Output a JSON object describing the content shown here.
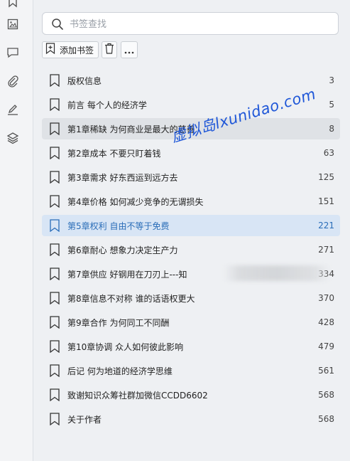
{
  "rail": {
    "icons": [
      "bookmark-icon",
      "image-icon",
      "comment-icon",
      "attachment-icon",
      "pen-icon",
      "layers-icon"
    ]
  },
  "search": {
    "placeholder": "书签查找",
    "value": ""
  },
  "toolbar": {
    "add_label": "添加书签"
  },
  "bookmarks": [
    {
      "title": "版权信息",
      "page": "3"
    },
    {
      "title": "前言 每个人的经济学",
      "page": "5"
    },
    {
      "title": "第1章稀缺 为何商业是最大的慈善",
      "page": "8"
    },
    {
      "title": "第2章成本 不要只盯着钱",
      "page": "63"
    },
    {
      "title": "第3章需求 好东西运到远方去",
      "page": "125"
    },
    {
      "title": "第4章价格 如何减少竞争的无谓损失",
      "page": "151"
    },
    {
      "title": "第5章权利 自由不等于免费",
      "page": "221"
    },
    {
      "title": "第6章耐心 想象力决定生产力",
      "page": "271"
    },
    {
      "title": "第7章供应 好钢用在刀刃上---知",
      "page": "334"
    },
    {
      "title": "第8章信息不对称 谁的话语权更大",
      "page": "370"
    },
    {
      "title": "第9章合作 为何同工不同酬",
      "page": "428"
    },
    {
      "title": "第10章协调 众人如何彼此影响",
      "page": "479"
    },
    {
      "title": "后记 何为地道的经济学思维",
      "page": "561"
    },
    {
      "title": "致谢知识众筹社群加微信CCDD6602",
      "page": "568"
    },
    {
      "title": "关于作者",
      "page": "568"
    }
  ],
  "watermark": "虚拟岛lxunidao.com",
  "colors": {
    "active_row": "#d8e5f5",
    "active_text": "#2a6db8",
    "hover_row": "#dfe2e6",
    "watermark": "#1f57d8"
  }
}
